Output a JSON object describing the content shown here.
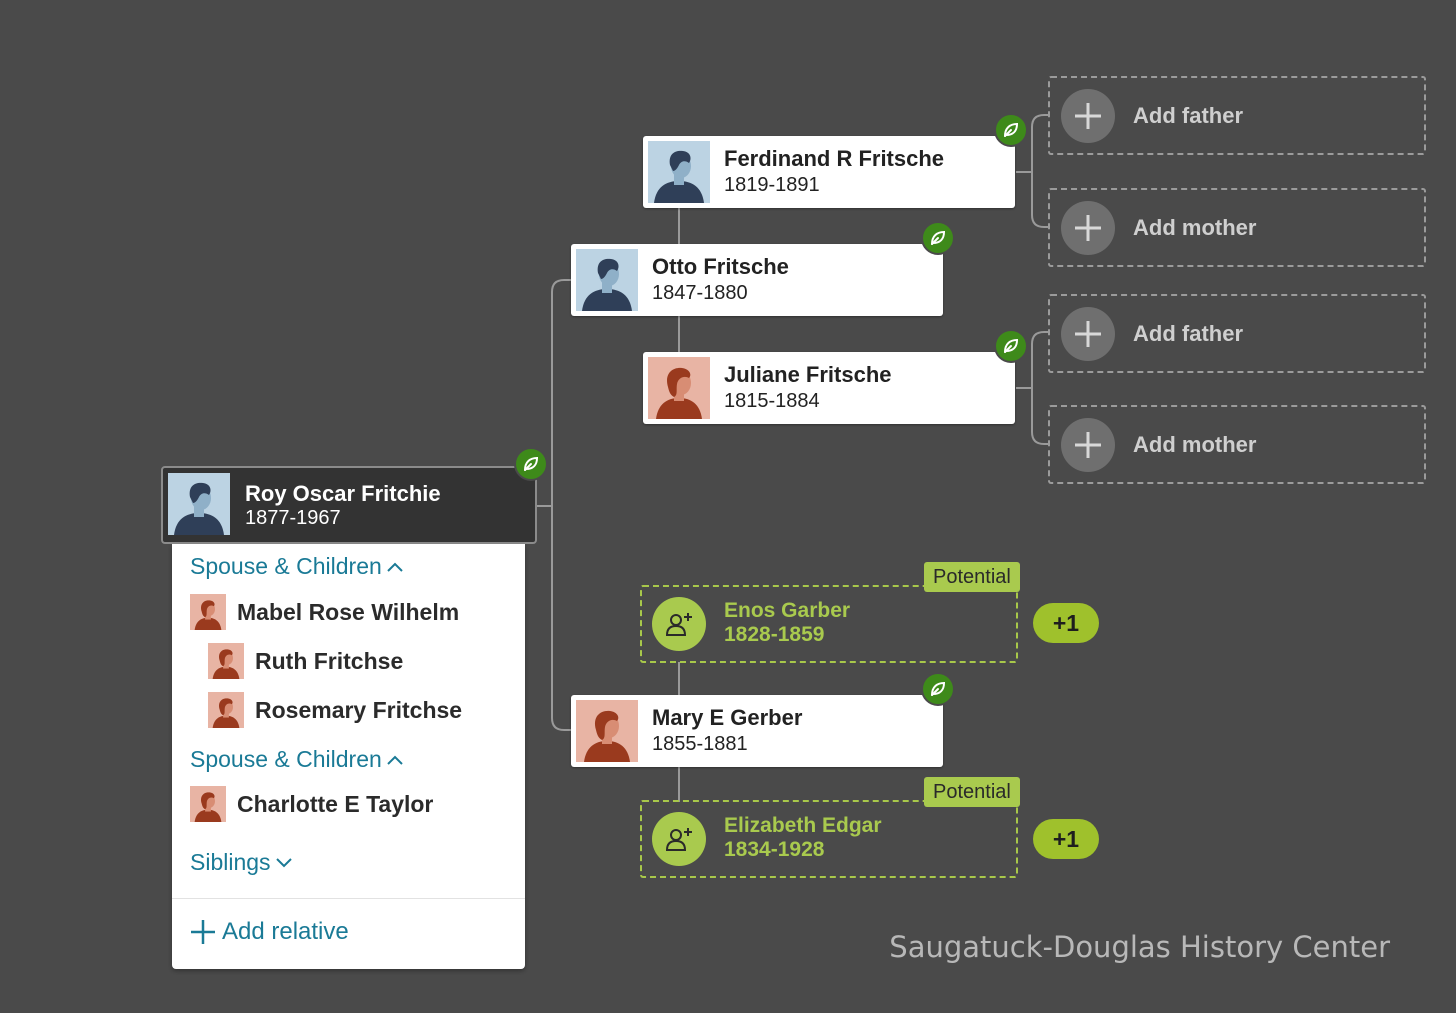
{
  "colors": {
    "background": "#4a4a4a",
    "hint_green": "#3e8a1a",
    "potential_green": "#a9ca4e",
    "link_blue": "#1a7a96",
    "male_avatar_bg": "#bcd3e3",
    "female_avatar_bg": "#e8b4a4"
  },
  "focus_person": {
    "name": "Roy Oscar Fritchie",
    "dates": "1877-1967",
    "gender": "male"
  },
  "ancestors": {
    "father": {
      "name": "Otto Fritsche",
      "dates": "1847-1880",
      "gender": "male"
    },
    "paternal_grandfather": {
      "name": "Ferdinand R Fritsche",
      "dates": "1819-1891",
      "gender": "male"
    },
    "paternal_grandmother": {
      "name": "Juliane Fritsche",
      "dates": "1815-1884",
      "gender": "female"
    },
    "mother": {
      "name": "Mary E Gerber",
      "dates": "1855-1881",
      "gender": "female"
    }
  },
  "add_placeholders": {
    "add_father": "Add father",
    "add_mother": "Add mother"
  },
  "potentials": [
    {
      "tag": "Potential",
      "name": "Enos Garber",
      "dates": "1828-1859",
      "count": "+1"
    },
    {
      "tag": "Potential",
      "name": "Elizabeth Edgar",
      "dates": "1834-1928",
      "count": "+1"
    }
  ],
  "family_panel": {
    "section1": "Spouse & Children",
    "spouse1": "Mabel Rose Wilhelm",
    "children1": [
      "Ruth Fritchse",
      "Rosemary Fritchse"
    ],
    "section2": "Spouse & Children",
    "spouse2": "Charlotte E Taylor",
    "siblings": "Siblings",
    "add_relative": "Add relative"
  },
  "watermark": "Saugatuck-Douglas History Center"
}
